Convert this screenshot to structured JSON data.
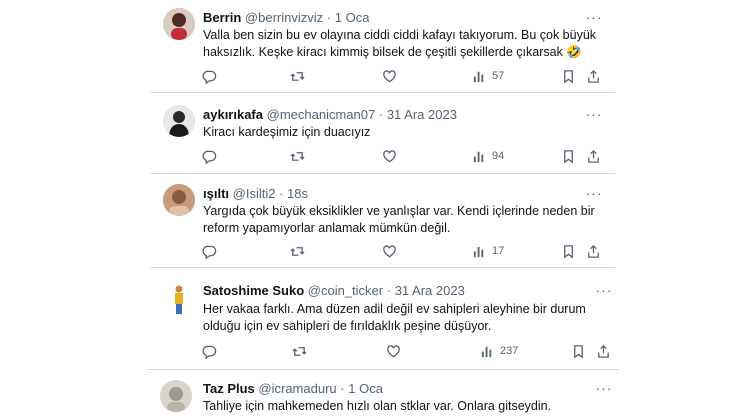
{
  "tweets": [
    {
      "name": "Berrin",
      "handle": "@berrinvizviz",
      "dot": "·",
      "date": "1 Oca",
      "lines": [
        "Valla ben sizin bu ev olayına ciddi ciddi kafayı takıyorum. Bu çok büyük",
        "haksızlık. Keşke kiracı kimmiş bilsek de çeşitli şekillerde çıkarsak 🤣"
      ],
      "views": "57"
    },
    {
      "name": "aykırıkafa",
      "handle": "@mechanicman07",
      "dot": "·",
      "date": "31 Ara 2023",
      "lines": [
        "Kiracı kardeşimiz için duacıyız"
      ],
      "views": "94"
    },
    {
      "name": "ışıltı",
      "handle": "@Isilti2",
      "dot": "·",
      "date": "18s",
      "lines": [
        "Yargıda çok büyük eksiklikler ve yanlışlar var. Kendi içlerinde neden bir",
        "reform yapamıyorlar anlamak mümkün değil."
      ],
      "views": "17"
    },
    {
      "name": "Satoshime Suko",
      "handle": "@coin_ticker",
      "dot": "·",
      "date": "31 Ara 2023",
      "lines": [
        "Her vakaa farklı. Ama düzen adil değil ev sahipleri aleyhine bir durum",
        "olduğu için ev sahipleri de fırıldaklık peşine düşüyor."
      ],
      "views": "237"
    },
    {
      "name": "Taz Plus",
      "handle": "@icramaduru",
      "dot": "·",
      "date": "1 Oca",
      "lines": [
        "Tahliye için mahkemeden hızlı olan stklar var. Onlara gitseydin."
      ]
    }
  ],
  "icons": {
    "more": "more-options-icon",
    "reply": "reply-icon",
    "retweet": "retweet-icon",
    "like": "like-icon",
    "views": "views-icon",
    "bookmark": "bookmark-icon",
    "share": "share-icon"
  },
  "colors": {
    "text": "#0f1419",
    "muted": "#536471",
    "separator": "#d8dde1"
  }
}
